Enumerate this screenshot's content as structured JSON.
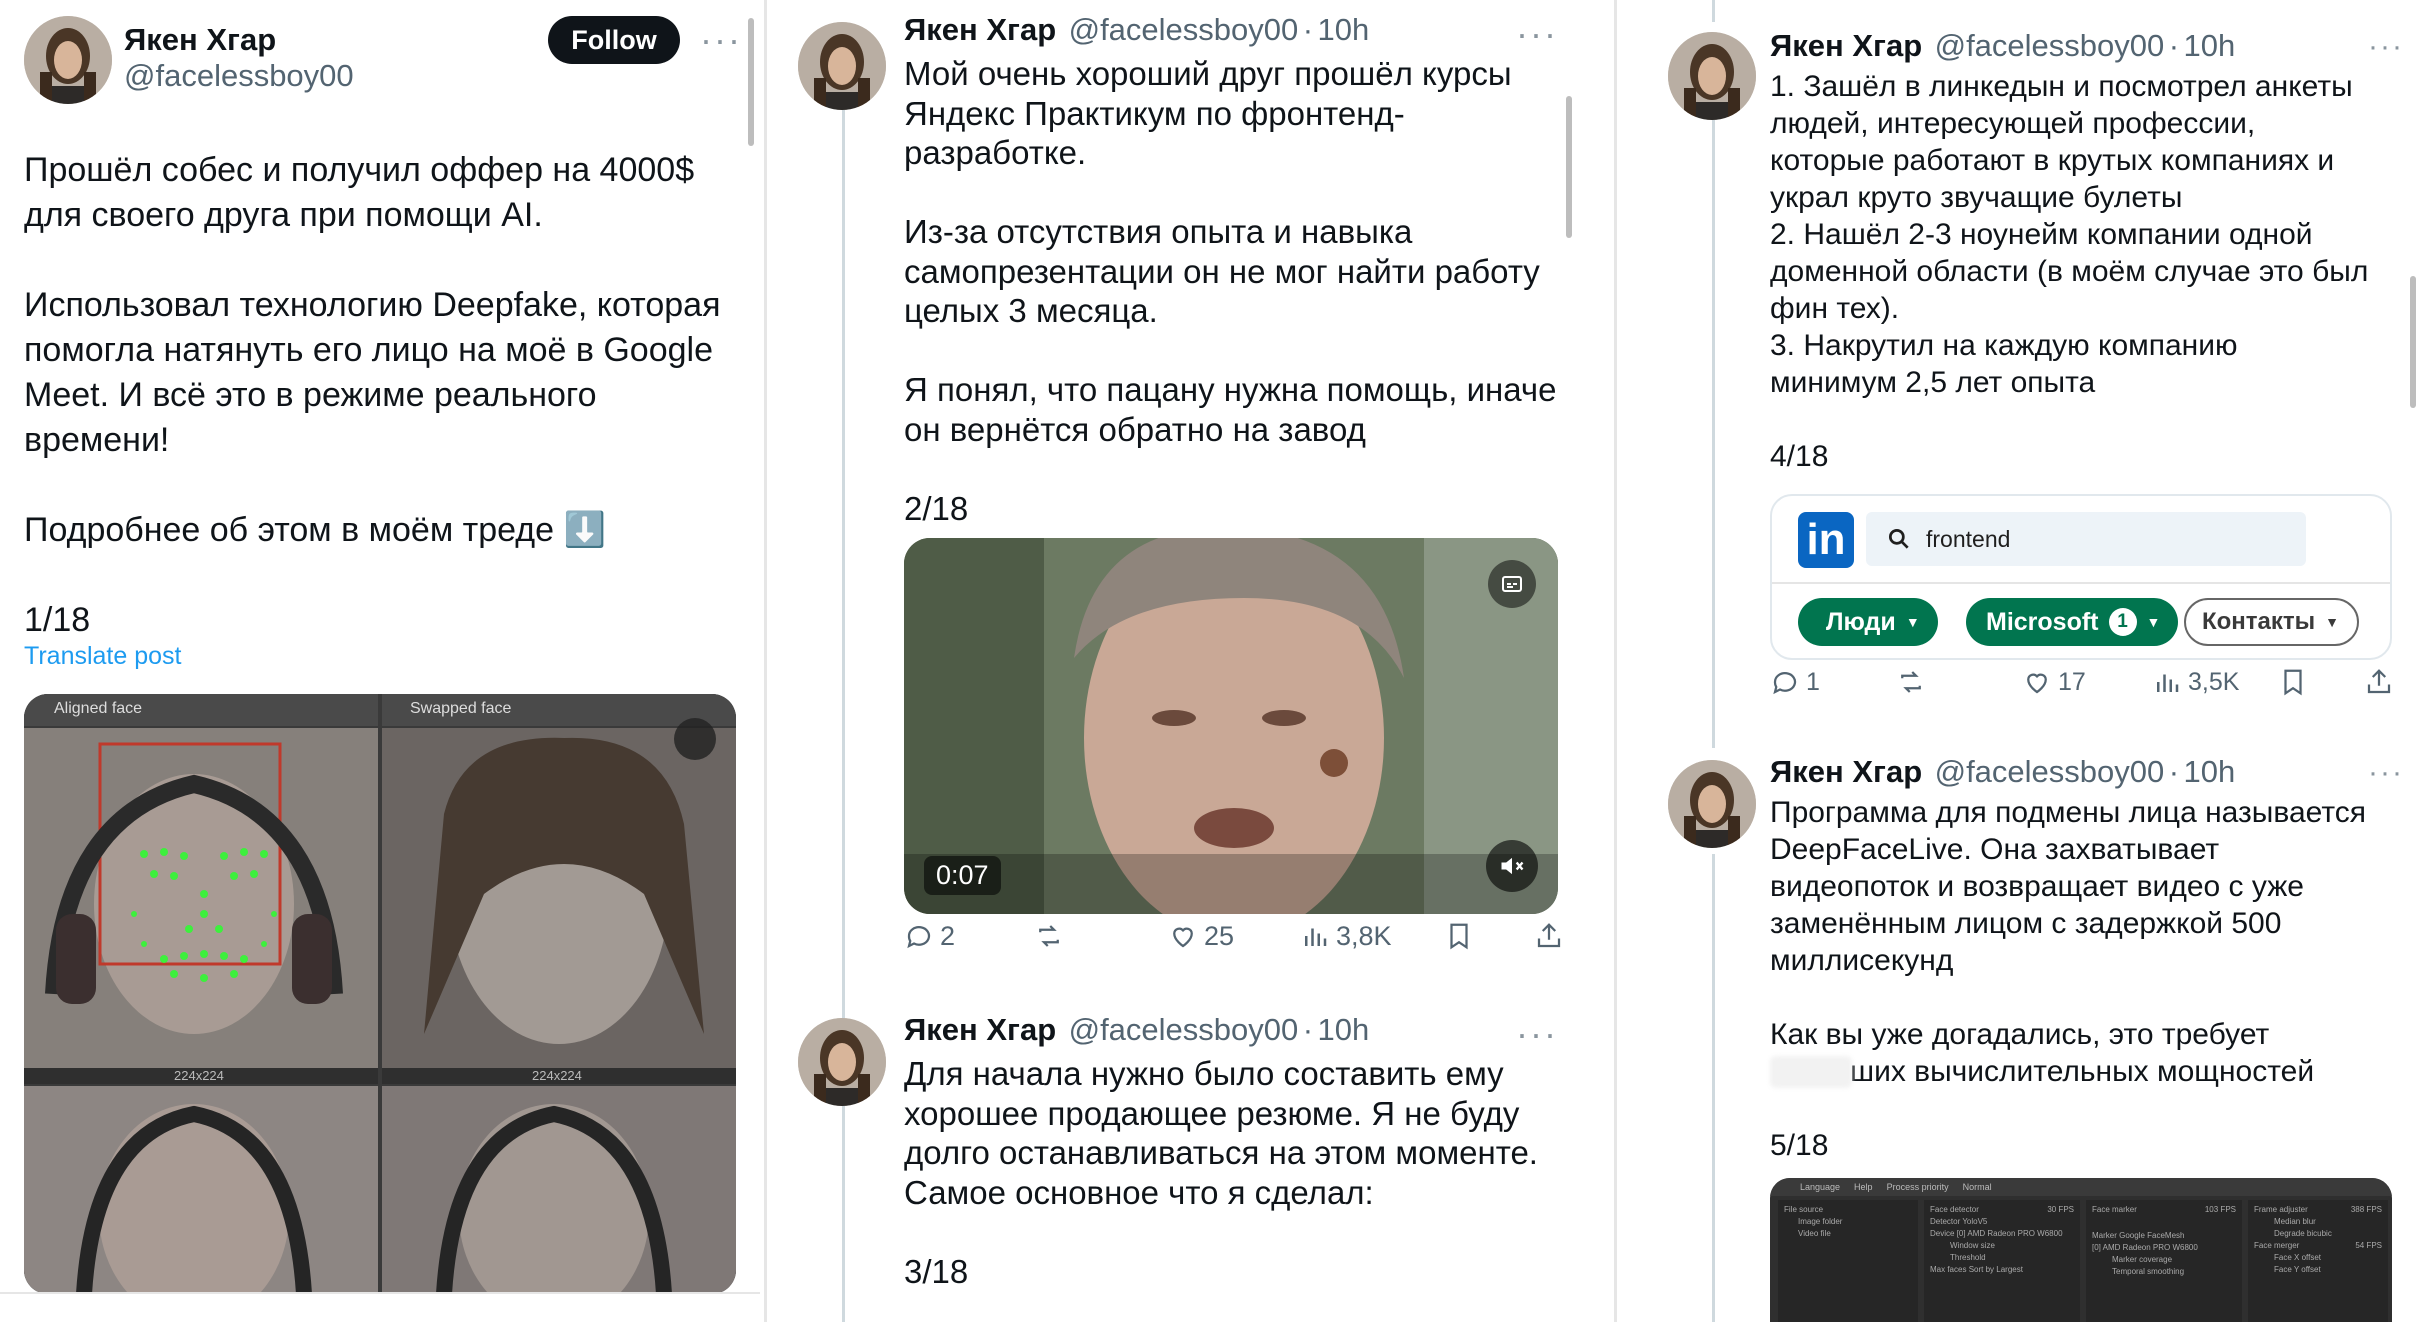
{
  "author": {
    "name": "Якен Хгар",
    "handle": "@facelessboy00",
    "time": "10h",
    "separator": "·"
  },
  "col1": {
    "follow_label": "Follow",
    "body": "Прошёл собес и получил оффер на 4000$\nдля своего друга при помощи AI.\n\nИспользовал технологию Deepfake, которая\nпомогла натянуть его лицо на моё в Google\nMeet. И всё это в режиме реального времени!\n\nПодробнее об этом в моём треде ⬇️\n\n1/18",
    "translate_label": "Translate post",
    "media": {
      "label_left": "Aligned face",
      "label_right": "Swapped face",
      "caption_left": "224x224",
      "caption_right": "224x224"
    }
  },
  "col2": {
    "tweet2": {
      "body": "Мой очень хороший друг прошёл курсы\nЯндекс Практикум по фронтенд-\nразработке.\n\nИз-за отсутствия опыта и навыка\nсамопрезентации он не мог найти работу\nцелых 3 месяца.\n\nЯ понял, что пацану нужна помощь, иначе\nон вернётся обратно на завод\n\n2/18",
      "video_time": "0:07",
      "replies": "2",
      "likes": "25",
      "views": "3,8K"
    },
    "tweet3": {
      "body": "Для начала нужно было составить ему\nхорошее продающее резюме. Я не буду\nдолго останавливаться на этом моменте.\nСамое основное что я сделал:\n\n3/18"
    }
  },
  "col3": {
    "tweet4": {
      "body": "1. Зашёл в линкедын и посмотрел анкеты\nлюдей, интересующей профессии,\nкоторые работают в крутых компаниях и\nукрал круто звучащие булеты\n2. Нашёл 2-3 ноунейм компании одной\nдоменной области (в моём случае это был\nфин тех).\n3. Накрутил на каждую компанию\nминимум 2,5 лет опыта\n\n4/18",
      "linkedin": {
        "logo": "in",
        "search_value": "frontend",
        "filter_people": "Люди",
        "filter_company": "Microsoft",
        "filter_company_count": "1",
        "filter_contacts": "Контакты"
      },
      "replies": "1",
      "likes": "17",
      "views": "3,5K"
    },
    "tweet5": {
      "body": "Программа для подмены лица называется\nDeepFaceLive. Она захватывает\nвидеопоток и возвращает видео с уже\nзаменённым лицом с задержкой 500\nмиллисекунд\n\nКак вы уже догадались, это требует\n\n\n5/18",
      "body_partial": "ших вычислительных мощностей",
      "app_menu": [
        "Language",
        "Help",
        "Process priority",
        "Normal"
      ],
      "app_panels": [
        "File source",
        "Face detector",
        "Face marker",
        "Frame adjuster"
      ],
      "app_fields": [
        "Image folder",
        "Video file",
        "Detector",
        "YoloV5",
        "Device",
        "[0] AMD Radeon PRO W6800",
        "Window size",
        "Threshold",
        "Max faces",
        "Sort by",
        "Largest",
        "Marker",
        "Google FaceMesh",
        "Marker coverage",
        "Temporal smoothing",
        "Median blur",
        "Degrade bicubic",
        "Face merger",
        "Face X offset",
        "Face Y offset"
      ],
      "app_fps": [
        "30 FPS",
        "103 FPS",
        "388 FPS",
        "54 FPS"
      ]
    }
  },
  "colors": {
    "accent_link": "#1d9bf0",
    "linkedin_blue": "#0a66c2",
    "linkedin_green": "#01754f",
    "follow_bg": "#0f1419"
  }
}
